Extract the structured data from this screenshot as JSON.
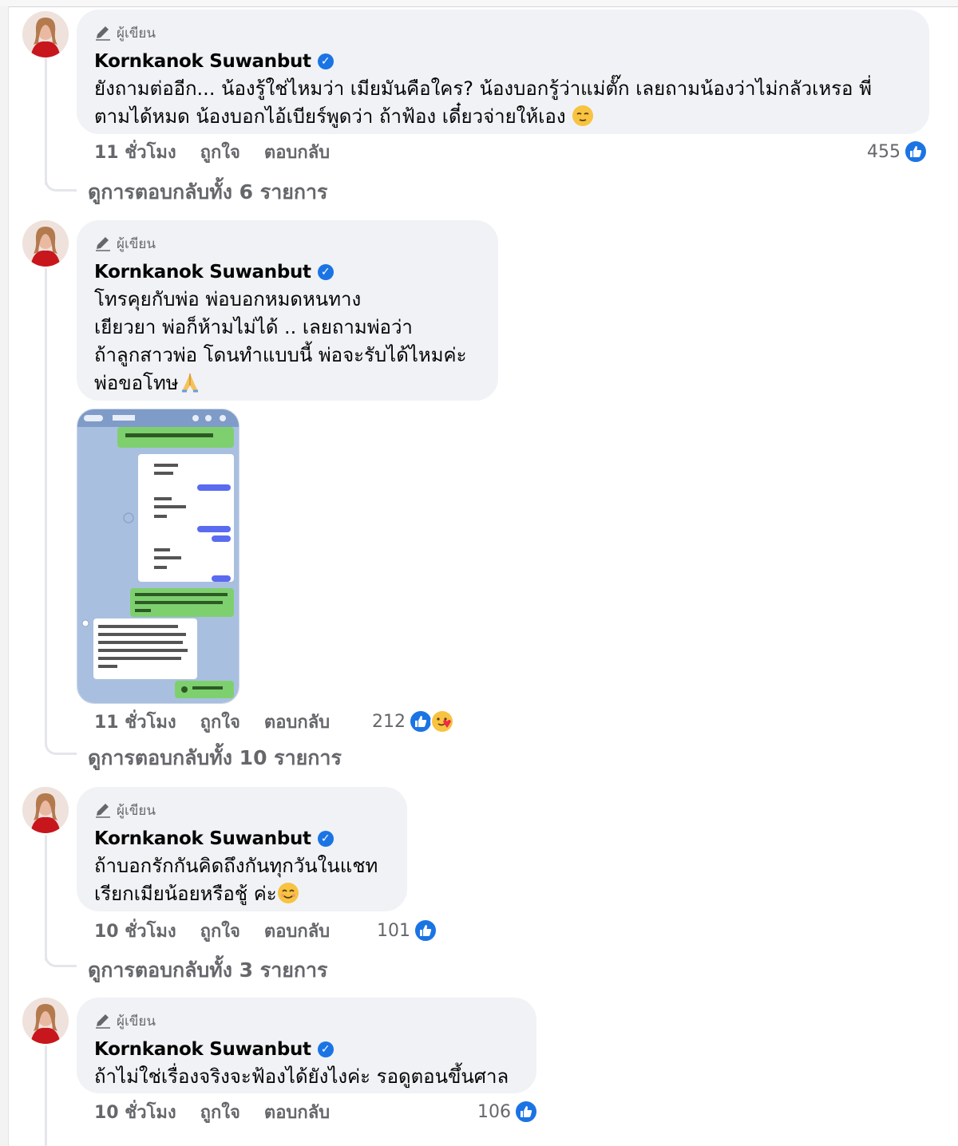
{
  "comments": [
    {
      "author_tag": "ผู้เขียน",
      "name": "Kornkanok Suwanbut",
      "lines": [
        "ยังถามต่ออีก... น้องรู้ใช่ไหมว่า เมียมันคือใคร? น้องบอกรู้ว่าแม่ตั๊ก เลยถามน้องว่าไม่กลัวเหรอ พี่",
        "ตามได้หมด น้องบอกไอ้เบียร์พูดว่า ถ้าฟ้อง เดี๋ยวจ่ายให้เอง"
      ],
      "time": "11 ชั่วโมง",
      "like_label": "ถูกใจ",
      "reply_label": "ตอบกลับ",
      "reaction_count": "455",
      "reaction_icons": [
        "like-icon"
      ],
      "view_replies": "ดูการตอบกลับทั้ง 6 รายการ"
    },
    {
      "author_tag": "ผู้เขียน",
      "name": "Kornkanok Suwanbut",
      "lines": [
        "โทรคุยกับพ่อ พ่อบอกหมดหนทาง",
        "เยียวยา พ่อก็ห้ามไม่ได้ .. เลยถามพ่อว่า",
        "ถ้าลูกสาวพ่อ โดนทำแบบนี้ พ่อจะรับได้ไหมค่ะ",
        "พ่อขอโทษ"
      ],
      "time": "11 ชั่วโมง",
      "like_label": "ถูกใจ",
      "reply_label": "ตอบกลับ",
      "reaction_count": "212",
      "reaction_icons": [
        "like-icon",
        "care-icon"
      ],
      "view_replies": "ดูการตอบกลับทั้ง 10 รายการ"
    },
    {
      "author_tag": "ผู้เขียน",
      "name": "Kornkanok Suwanbut",
      "lines": [
        "ถ้าบอกรักกันคิดถึงกันทุกวันในแชท",
        "เรียกเมียน้อยหรือชู้ ค่ะ"
      ],
      "time": "10 ชั่วโมง",
      "like_label": "ถูกใจ",
      "reply_label": "ตอบกลับ",
      "reaction_count": "101",
      "reaction_icons": [
        "like-icon"
      ],
      "view_replies": "ดูการตอบกลับทั้ง 3 รายการ"
    },
    {
      "author_tag": "ผู้เขียน",
      "name": "Kornkanok Suwanbut",
      "lines": [
        "ถ้าไม่ใช่เรื่องจริงจะฟ้องได้ยังไงค่ะ รอดูตอนขึ้นศาล"
      ],
      "time": "10 ชั่วโมง",
      "like_label": "ถูกใจ",
      "reply_label": "ตอบกลับ",
      "reaction_count": "106",
      "reaction_icons": [
        "like-icon"
      ]
    }
  ],
  "colors": {
    "bubble_bg": "#f0f2f5",
    "meta_text": "#65676b",
    "like_blue": "#1b74e4",
    "thread_line": "#e4e6eb"
  }
}
